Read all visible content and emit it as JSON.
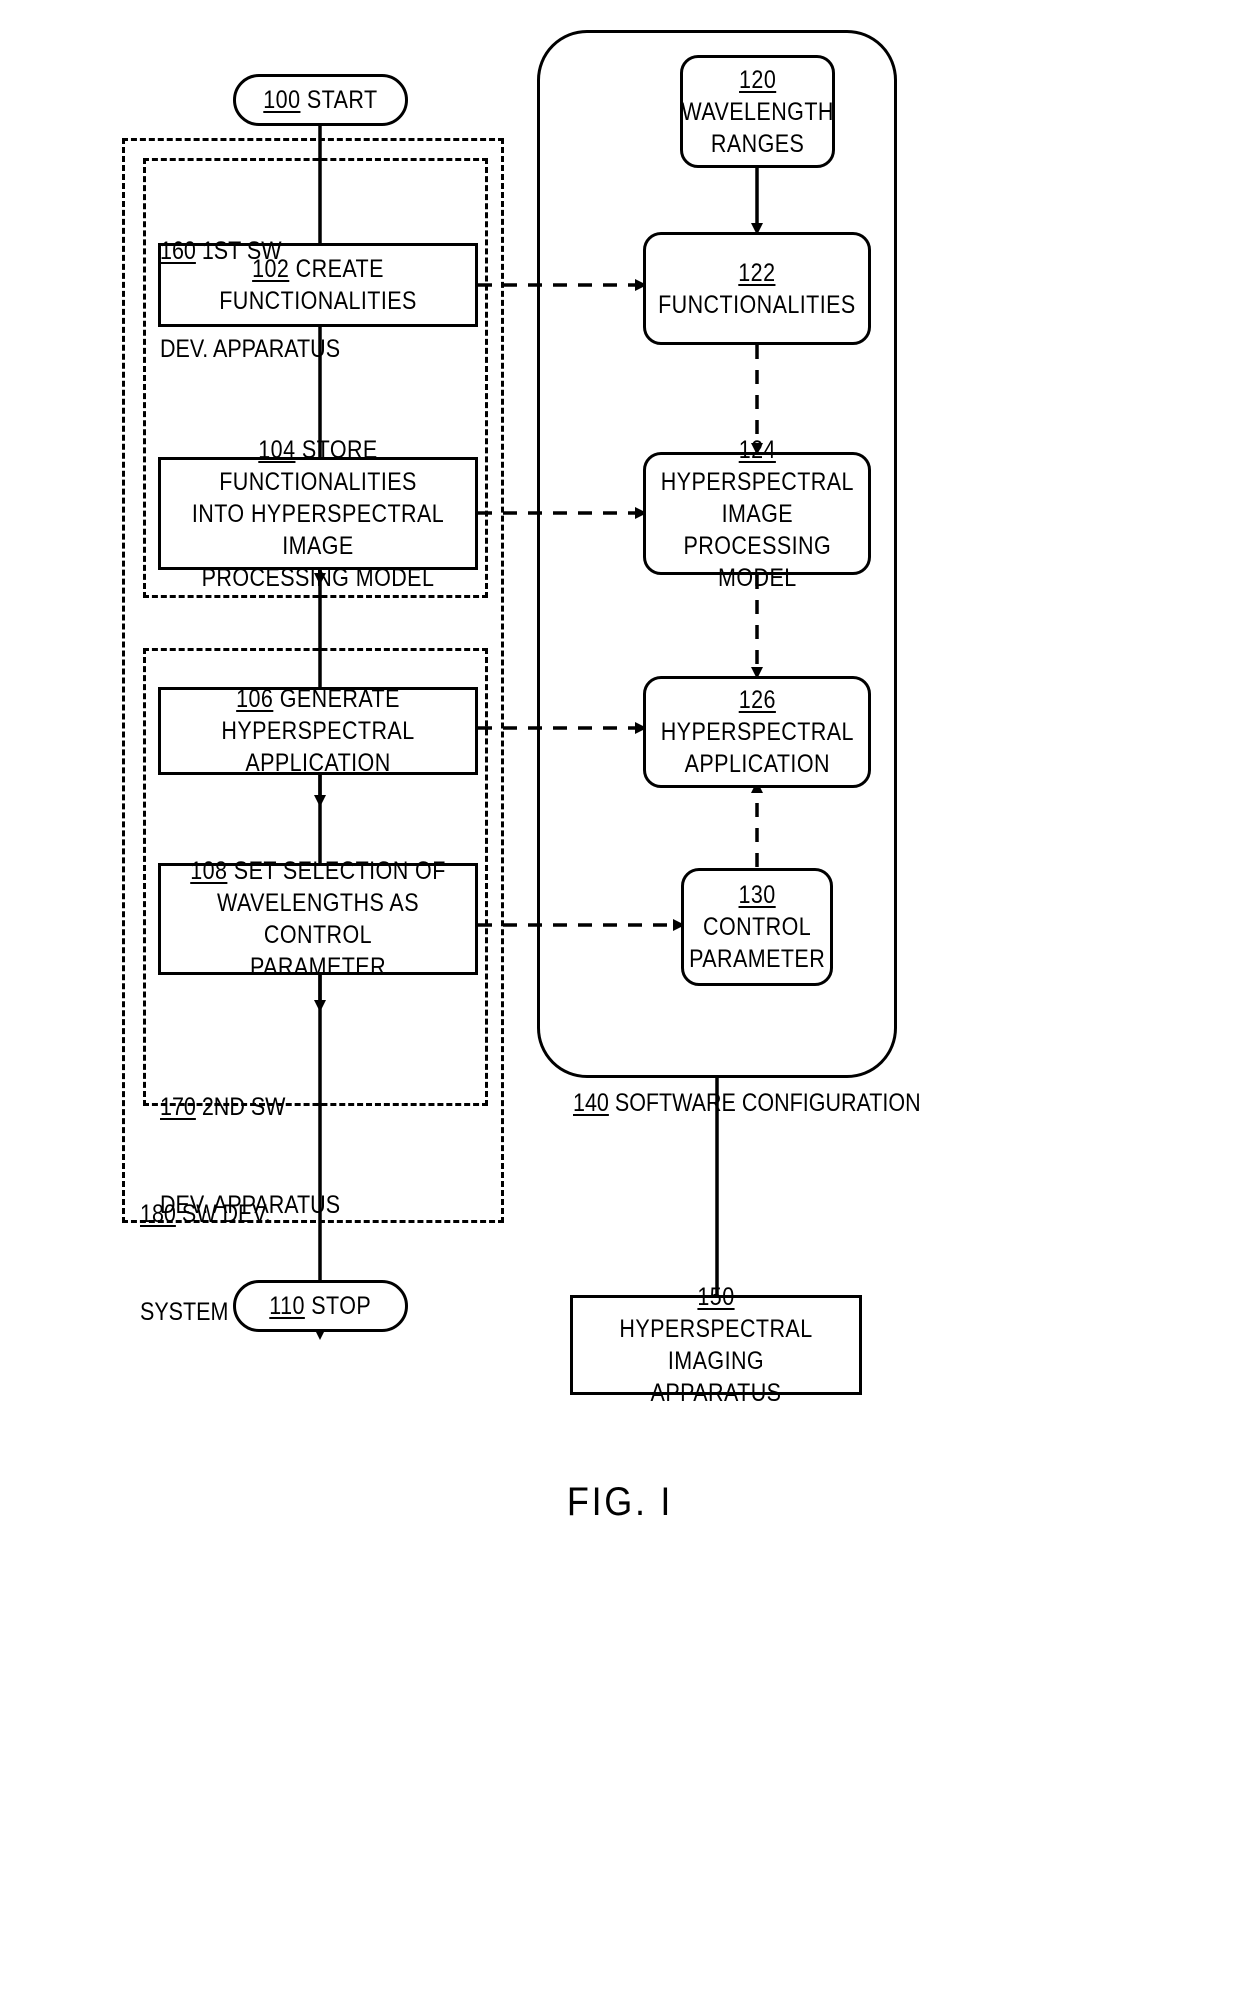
{
  "figure": {
    "caption": "FIG. I"
  },
  "left_flow": {
    "start": {
      "ref": "100",
      "label": "START"
    },
    "stop": {
      "ref": "110",
      "label": "STOP"
    },
    "steps": [
      {
        "ref": "102",
        "lines": [
          "102 CREATE FUNCTIONALITIES"
        ]
      },
      {
        "ref": "104",
        "lines": [
          "104 STORE FUNCTIONALITIES",
          "INTO HYPERSPECTRAL IMAGE",
          "PROCESSING MODEL"
        ]
      },
      {
        "ref": "106",
        "lines": [
          "106 GENERATE HYPERSPECTRAL",
          "APPLICATION"
        ]
      },
      {
        "ref": "108",
        "lines": [
          "108 SET SELECTION OF",
          "WAVELENGTHS AS CONTROL",
          "PARAMETER"
        ]
      }
    ],
    "groups": [
      {
        "ref": "160",
        "lines": [
          "160 1ST SW",
          "DEV. APPARATUS"
        ]
      },
      {
        "ref": "170",
        "lines": [
          "170 2ND SW",
          "DEV. APPARATUS"
        ]
      },
      {
        "ref": "180",
        "lines": [
          "180 SW DEV.",
          "SYSTEM"
        ]
      }
    ]
  },
  "right_config": {
    "container": {
      "ref": "140",
      "label": "140 SOFTWARE CONFIGURATION"
    },
    "blocks": [
      {
        "ref": "120",
        "lines": [
          "120",
          "WAVELENGTH",
          "RANGES"
        ]
      },
      {
        "ref": "122",
        "lines": [
          "122",
          "FUNCTIONALITIES"
        ]
      },
      {
        "ref": "124",
        "lines": [
          "124 HYPERSPECTRAL",
          "IMAGE PROCESSING",
          "MODEL"
        ]
      },
      {
        "ref": "126",
        "lines": [
          "126 HYPERSPECTRAL",
          "APPLICATION"
        ]
      },
      {
        "ref": "130",
        "lines": [
          "130",
          "CONTROL",
          "PARAMETER"
        ]
      }
    ],
    "apparatus": {
      "ref": "150",
      "lines": [
        "150 HYPERSPECTRAL",
        "IMAGING APPARATUS"
      ]
    }
  }
}
